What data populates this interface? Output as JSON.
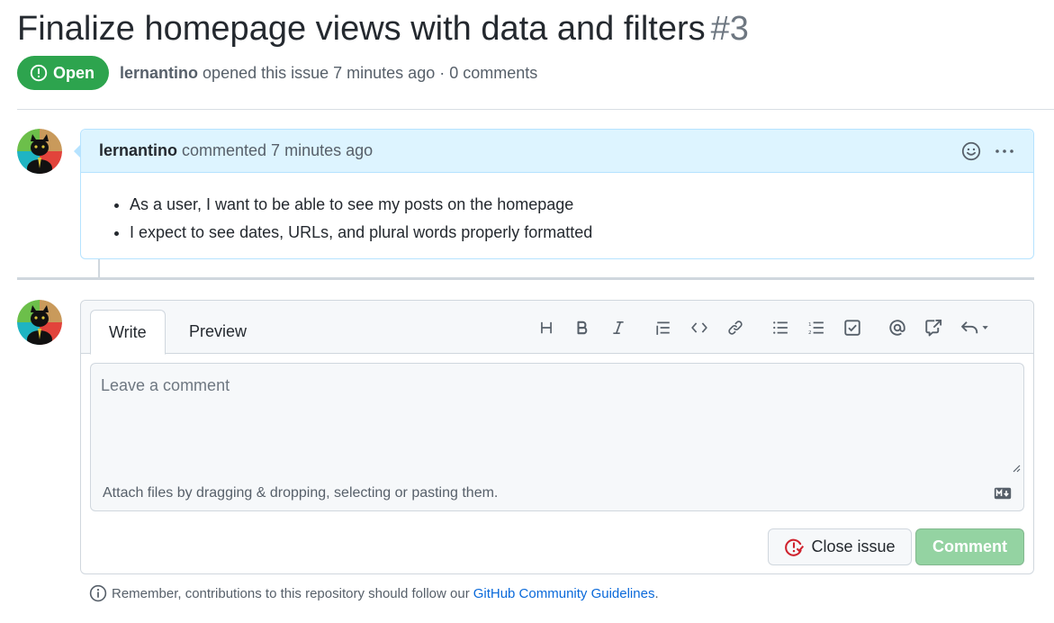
{
  "issue": {
    "title": "Finalize homepage views with data and filters",
    "number": "#3",
    "state": "Open",
    "author": "lernantino",
    "opened_text": "opened this issue 7 minutes ago · 0 comments"
  },
  "comment": {
    "author": "lernantino",
    "time_text": "commented 7 minutes ago",
    "items": [
      "As a user, I want to be able to see my posts on the homepage",
      "I expect to see dates, URLs, and plural words properly formatted"
    ]
  },
  "editor": {
    "tabs": {
      "write": "Write",
      "preview": "Preview"
    },
    "placeholder": "Leave a comment",
    "attach_text": "Attach files by dragging & dropping, selecting or pasting them.",
    "close_label": "Close issue",
    "comment_label": "Comment"
  },
  "footer": {
    "note": "Remember, contributions to this repository should follow our",
    "link": "GitHub Community Guidelines",
    "end": "."
  },
  "colors": {
    "open_green": "#2da44e",
    "comment_disabled": "#94d3a2",
    "link_blue": "#0969da",
    "close_red": "#cf222e"
  }
}
